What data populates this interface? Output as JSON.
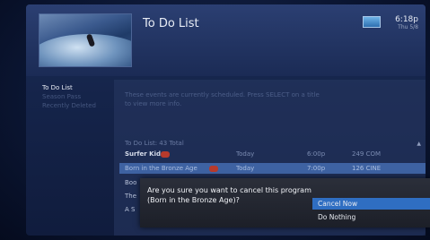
{
  "header": {
    "title": "To Do List",
    "time": "6:18p",
    "date": "Thu 5/8"
  },
  "sidebar": {
    "items": [
      "To Do List",
      "Season Pass",
      "Recently Deleted",
      "",
      "",
      "",
      "",
      ""
    ]
  },
  "info_text": "These events are currently scheduled. Press SELECT on a title to view more info.",
  "list": {
    "header": "To Do List: 43 Total",
    "rows": [
      {
        "title": "Surfer Kid",
        "date": "Today",
        "time": "6:00p",
        "channel": "249 COM"
      },
      {
        "title": "Born in the Bronze Age",
        "date": "Today",
        "time": "7:00p",
        "channel": "126 CINE"
      },
      {
        "title": "Boo",
        "date": "",
        "time": "",
        "channel": ""
      },
      {
        "title": "The",
        "date": "",
        "time": "",
        "channel": ""
      },
      {
        "title": "A S",
        "date": "",
        "time": "",
        "channel": ""
      }
    ]
  },
  "dialog": {
    "question": "Are you sure you want to cancel this program (Born in the Bronze Age)?",
    "options": [
      "Cancel Now",
      "Do Nothing"
    ]
  },
  "colors": {
    "accent": "#2f6ec2",
    "selected_row": "#3e62a2",
    "background": "#15244a",
    "badge": "#b73a2c"
  }
}
